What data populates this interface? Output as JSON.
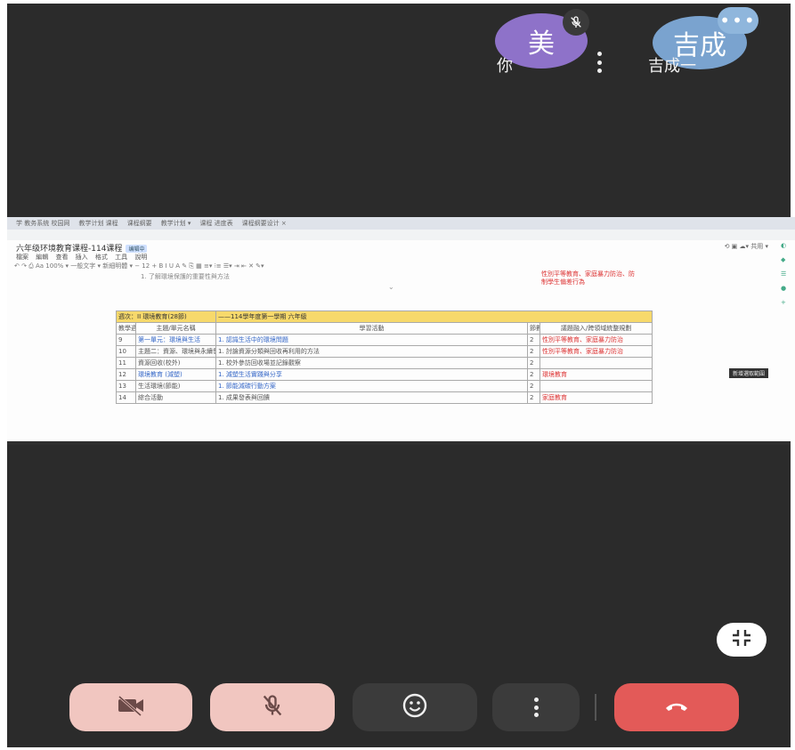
{
  "participants": {
    "me": {
      "initial": "美",
      "label": "你",
      "color": "#8e72c9"
    },
    "other": {
      "initial": "吉成",
      "label": "吉成一",
      "color": "#7aa3cf"
    }
  },
  "shared_screen": {
    "browser_tabs": [
      "学 教务系统 校园网",
      "教学计划 课程",
      "课程纲要",
      "教学计划 ▾",
      "课程 进度表",
      "课程纲要设计 ×"
    ],
    "doc_title": "六年级环境教育课程-114课程",
    "doc_badge": "编辑中",
    "doc_menu": "檔案 編輯 查看 插入 格式 工具 說明",
    "toolbar_text": "↶ ↷ ⎙ Aa 100% ▾  一般文字 ▾  新細明體 ▾  − 12 +  B  I  U  A  ✎  ⎘  ▦  ≡▾  ⁝≡  ☰▾  ⇥  ⇤  ✕  ✎▾",
    "doc_right": "⟲  ▣  ☁▾  共用 ▾",
    "side_icons": [
      "◐",
      "◆",
      "☰",
      "●",
      "+"
    ],
    "top_note": "1. 了解環境保護的重要性與方法",
    "top_note_red": "性別平等教育、家庭暴力防治、防制學生偏差行為",
    "caret": "⌄",
    "tooltip": "新增選取範圍",
    "table": {
      "section_header": [
        "週次：II 環境教育(28節)",
        "——114學年度第一學期 六年級"
      ],
      "columns": [
        "教學週次",
        "主題/單元名稱",
        "學習活動",
        "節數",
        "議題融入/跨領域統整規劃"
      ],
      "rows": [
        [
          "9",
          "第一單元：環境與生活",
          "1. 認識生活中的環境問題",
          "2",
          "性別平等教育、家庭暴力防治"
        ],
        [
          "10",
          "主題二：資源、環境與永續發展",
          "1. 討論資源分類與回收再利用的方法",
          "2",
          "性別平等教育、家庭暴力防治"
        ],
        [
          "11",
          "資源回收(校外)",
          "1. 校外參訪回收場並記錄觀察",
          "2",
          ""
        ],
        [
          "12",
          "環境教育 (減塑)",
          "1. 減塑生活實踐與分享",
          "2",
          "環境教育"
        ],
        [
          "13",
          "生活環境(節能)",
          "1. 節能減碳行動方案",
          "2",
          ""
        ],
        [
          "14",
          "綜合活動",
          "1. 成果發表與回饋",
          "2",
          "家庭教育"
        ]
      ]
    }
  },
  "controls": {
    "camera": "camera-off",
    "mic": "mic-off",
    "reactions": "emoji",
    "more": "more-options",
    "hangup": "end-call",
    "fullscreen": "exit-fullscreen"
  },
  "colors": {
    "background": "#2b2b2b",
    "muted_button": "#f1c6c0",
    "hangup": "#e35a58"
  }
}
